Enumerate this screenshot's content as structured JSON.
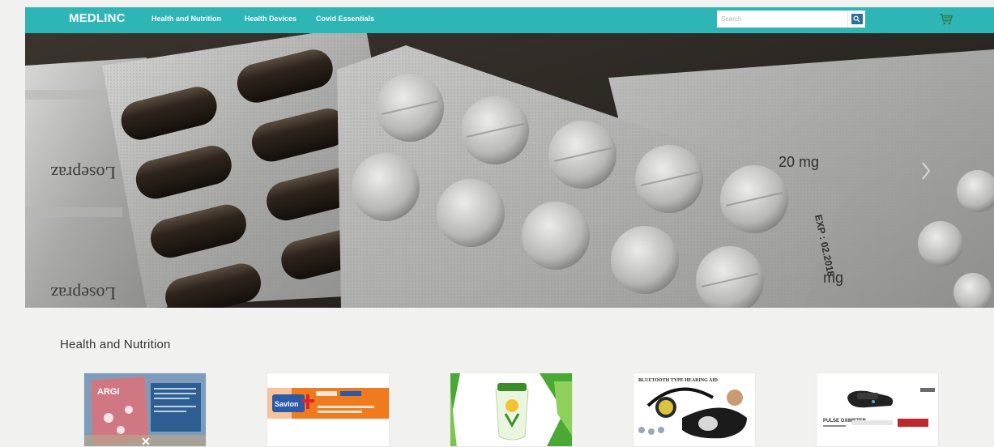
{
  "navbar": {
    "brand": "MEDLINC",
    "links": [
      "Health and Nutrition",
      "Health Devices",
      "Covid Essentials"
    ],
    "search_placeholder": "Search"
  },
  "hero": {
    "packet_texts": [
      "Losepraz",
      "Losepraz",
      "20 mg",
      "mg",
      "EXP : 02.2018"
    ]
  },
  "section": {
    "title": "Health and Nutrition"
  },
  "products": [
    {
      "label_text": "ARGI"
    },
    {
      "label_text": "Savlon"
    },
    {
      "label_text": ""
    },
    {
      "label_text": "BLUETOOTH TYPE HEARING AID"
    },
    {
      "label_text": "PULSE OXIMETER"
    }
  ],
  "colors": {
    "navbar": "#2eb5b6",
    "page_bg": "#f1f1ef",
    "search_button": "#2b6f9a"
  }
}
